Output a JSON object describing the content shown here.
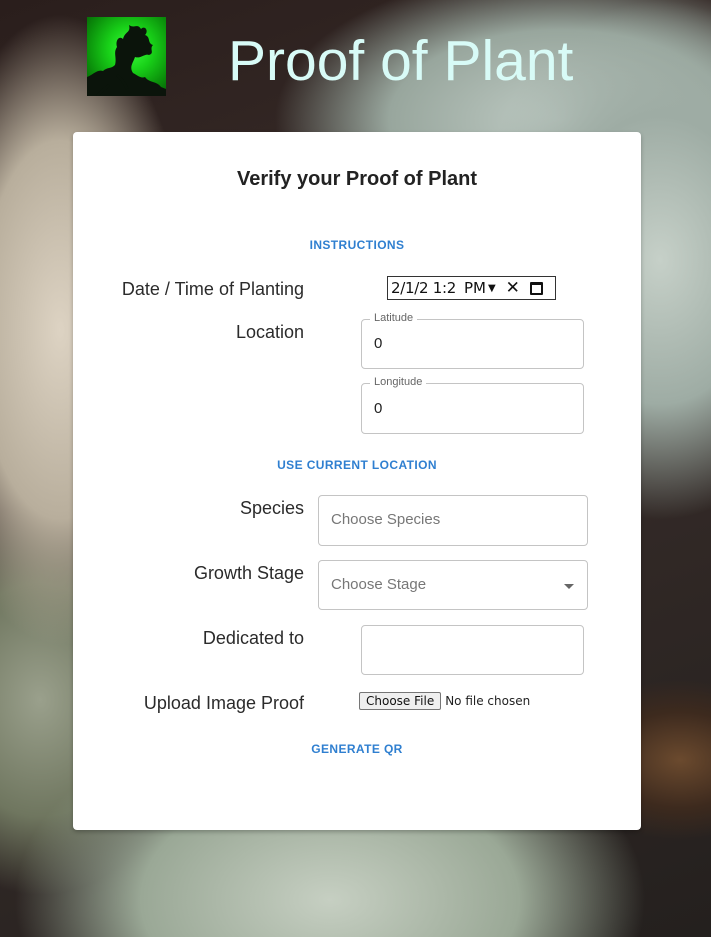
{
  "header": {
    "title": "Proof of Plant",
    "logo_icon": "fractal-logo-icon"
  },
  "form": {
    "heading": "Verify your Proof of Plant",
    "instructions_label": "INSTRUCTIONS",
    "date_time": {
      "label": "Date / Time of Planting",
      "value": "2/1/2 1:2",
      "ampm": "PM",
      "clear_icon": "close-icon",
      "calendar_icon": "calendar-icon"
    },
    "location": {
      "label": "Location",
      "latitude": {
        "legend": "Latitude",
        "value": "0"
      },
      "longitude": {
        "legend": "Longitude",
        "value": "0"
      }
    },
    "use_location_label": "USE CURRENT LOCATION",
    "species": {
      "label": "Species",
      "placeholder": "Choose Species"
    },
    "growth_stage": {
      "label": "Growth Stage",
      "placeholder": "Choose Stage",
      "icon": "chevron-down-icon"
    },
    "dedicated": {
      "label": "Dedicated to",
      "value": ""
    },
    "upload": {
      "label": "Upload Image Proof",
      "button": "Choose File",
      "status": "No file chosen"
    },
    "generate_label": "GENERATE QR"
  },
  "colors": {
    "title": "#d8fbf7",
    "accent": "#2f7fd0",
    "card": "#ffffff"
  }
}
